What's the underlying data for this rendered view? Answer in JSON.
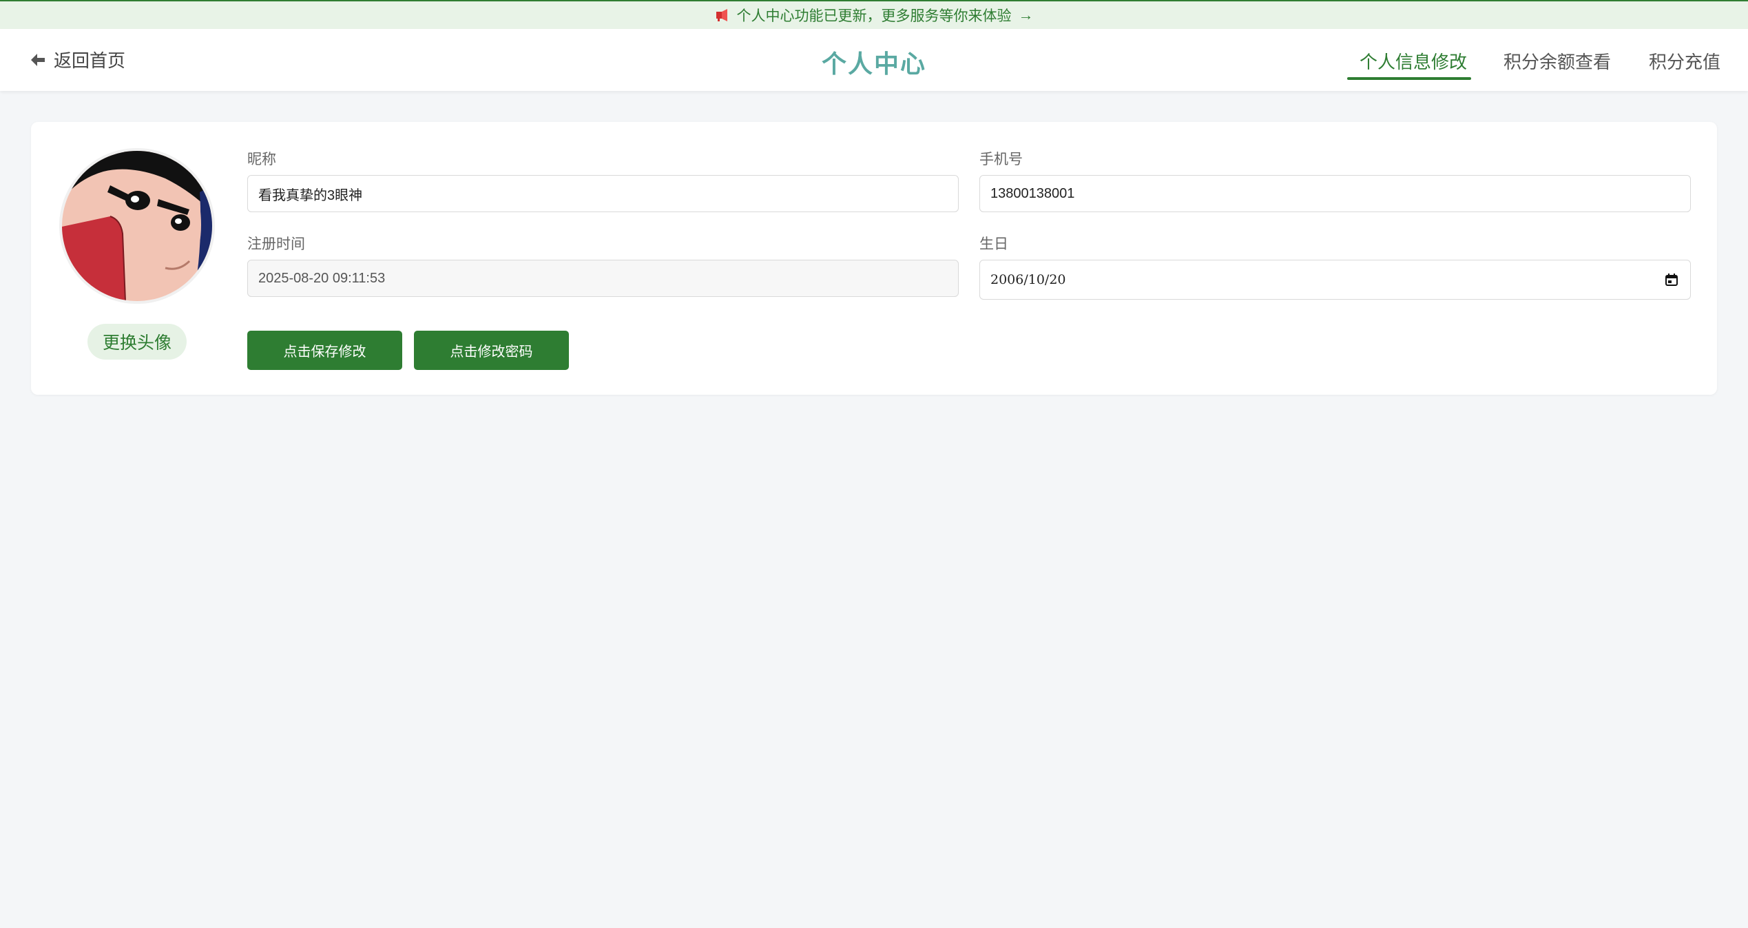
{
  "banner": {
    "icon": "megaphone-icon",
    "text": "个人中心功能已更新，更多服务等你来体验",
    "arrow": "→"
  },
  "header": {
    "back_label": "返回首页",
    "back_icon": "arrow-left-icon",
    "title": "个人中心",
    "tabs": [
      {
        "label": "个人信息修改",
        "active": true
      },
      {
        "label": "积分余额查看",
        "active": false
      },
      {
        "label": "积分充值",
        "active": false
      }
    ]
  },
  "profile": {
    "change_avatar_label": "更换头像",
    "fields": {
      "nickname": {
        "label": "昵称",
        "value": "看我真挚的3眼神"
      },
      "phone": {
        "label": "手机号",
        "value": "13800138001"
      },
      "register_time": {
        "label": "注册时间",
        "value": "2025-08-20 09:11:53"
      },
      "birthday": {
        "label": "生日",
        "value": "2006/10/20"
      }
    },
    "buttons": {
      "save": "点击保存修改",
      "change_password": "点击修改密码"
    }
  },
  "colors": {
    "accent": "#2e7d32",
    "title": "#5aa9a2",
    "banner_bg": "#e8f3e7",
    "page_bg": "#f4f6f8"
  }
}
